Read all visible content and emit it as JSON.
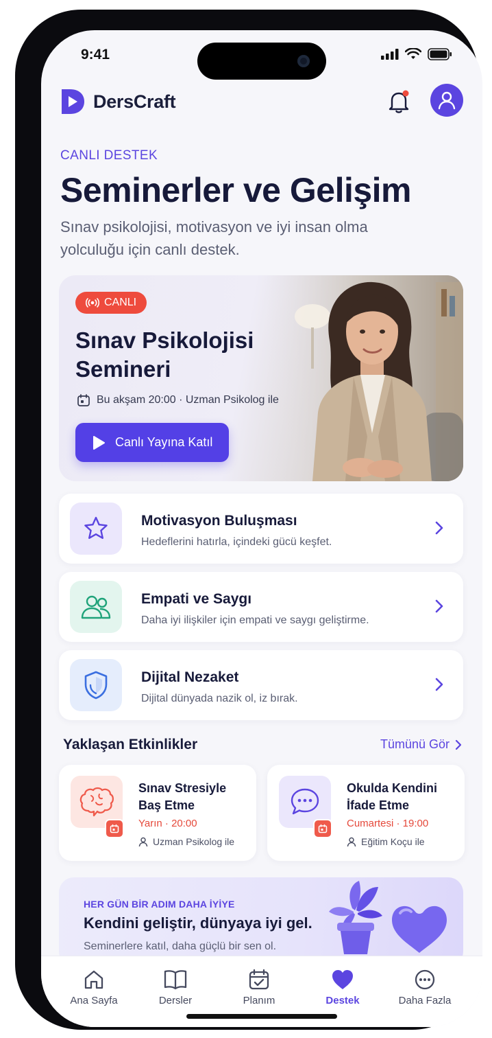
{
  "status": {
    "time": "9:41"
  },
  "header": {
    "app_name": "DersCraft"
  },
  "page": {
    "eyebrow": "CANLI DESTEK",
    "title": "Seminerler ve Gelişim",
    "subtitle": "Sınav psikolojisi, motivasyon ve iyi insan olma yolculuğu için canlı destek."
  },
  "hero": {
    "badge": "CANLI",
    "title": "Sınav Psikolojisi Semineri",
    "meta": "Bu akşam 20:00 · Uzman Psikolog ile",
    "button": "Canlı Yayına Katıl"
  },
  "features": [
    {
      "title": "Motivasyon Buluşması",
      "desc": "Hedeflerini hatırla, içindeki gücü keşfet.",
      "icon": "star-icon",
      "color": "#5b45e0"
    },
    {
      "title": "Empati ve Saygı",
      "desc": "Daha iyi ilişkiler için empati ve saygı geliştirme.",
      "icon": "people-icon",
      "color": "#1fa37a"
    },
    {
      "title": "Dijital Nezaket",
      "desc": "Dijital dünyada nazik ol, iz bırak.",
      "icon": "shield-icon",
      "color": "#3b6fe0"
    }
  ],
  "upcoming": {
    "title": "Yaklaşan Etkinlikler",
    "see_all": "Tümünü Gör",
    "events": [
      {
        "title": "Sınav Stresiyle Baş Etme",
        "time": "Yarın · 20:00",
        "host": "Uzman Psikolog ile",
        "icon": "brain-icon"
      },
      {
        "title": "Okulda Kendini İfade Etme",
        "time": "Cumartesi · 19:00",
        "host": "Eğitim Koçu ile",
        "icon": "chat-bubble-icon"
      }
    ]
  },
  "promo": {
    "eyebrow": "HER GÜN BİR ADIM DAHA İYİYE",
    "title": "Kendini geliştir, dünyaya iyi gel.",
    "subtitle": "Seminerlere katıl, daha güçlü bir sen ol."
  },
  "tabs": [
    {
      "label": "Ana Sayfa",
      "icon": "home-icon"
    },
    {
      "label": "Dersler",
      "icon": "book-icon"
    },
    {
      "label": "Planım",
      "icon": "calendar-check-icon"
    },
    {
      "label": "Destek",
      "icon": "heart-icon",
      "active": true
    },
    {
      "label": "Daha Fazla",
      "icon": "more-icon"
    }
  ],
  "colors": {
    "accent": "#5b45e0",
    "live": "#ee4b3d",
    "text": "#171a3a"
  }
}
